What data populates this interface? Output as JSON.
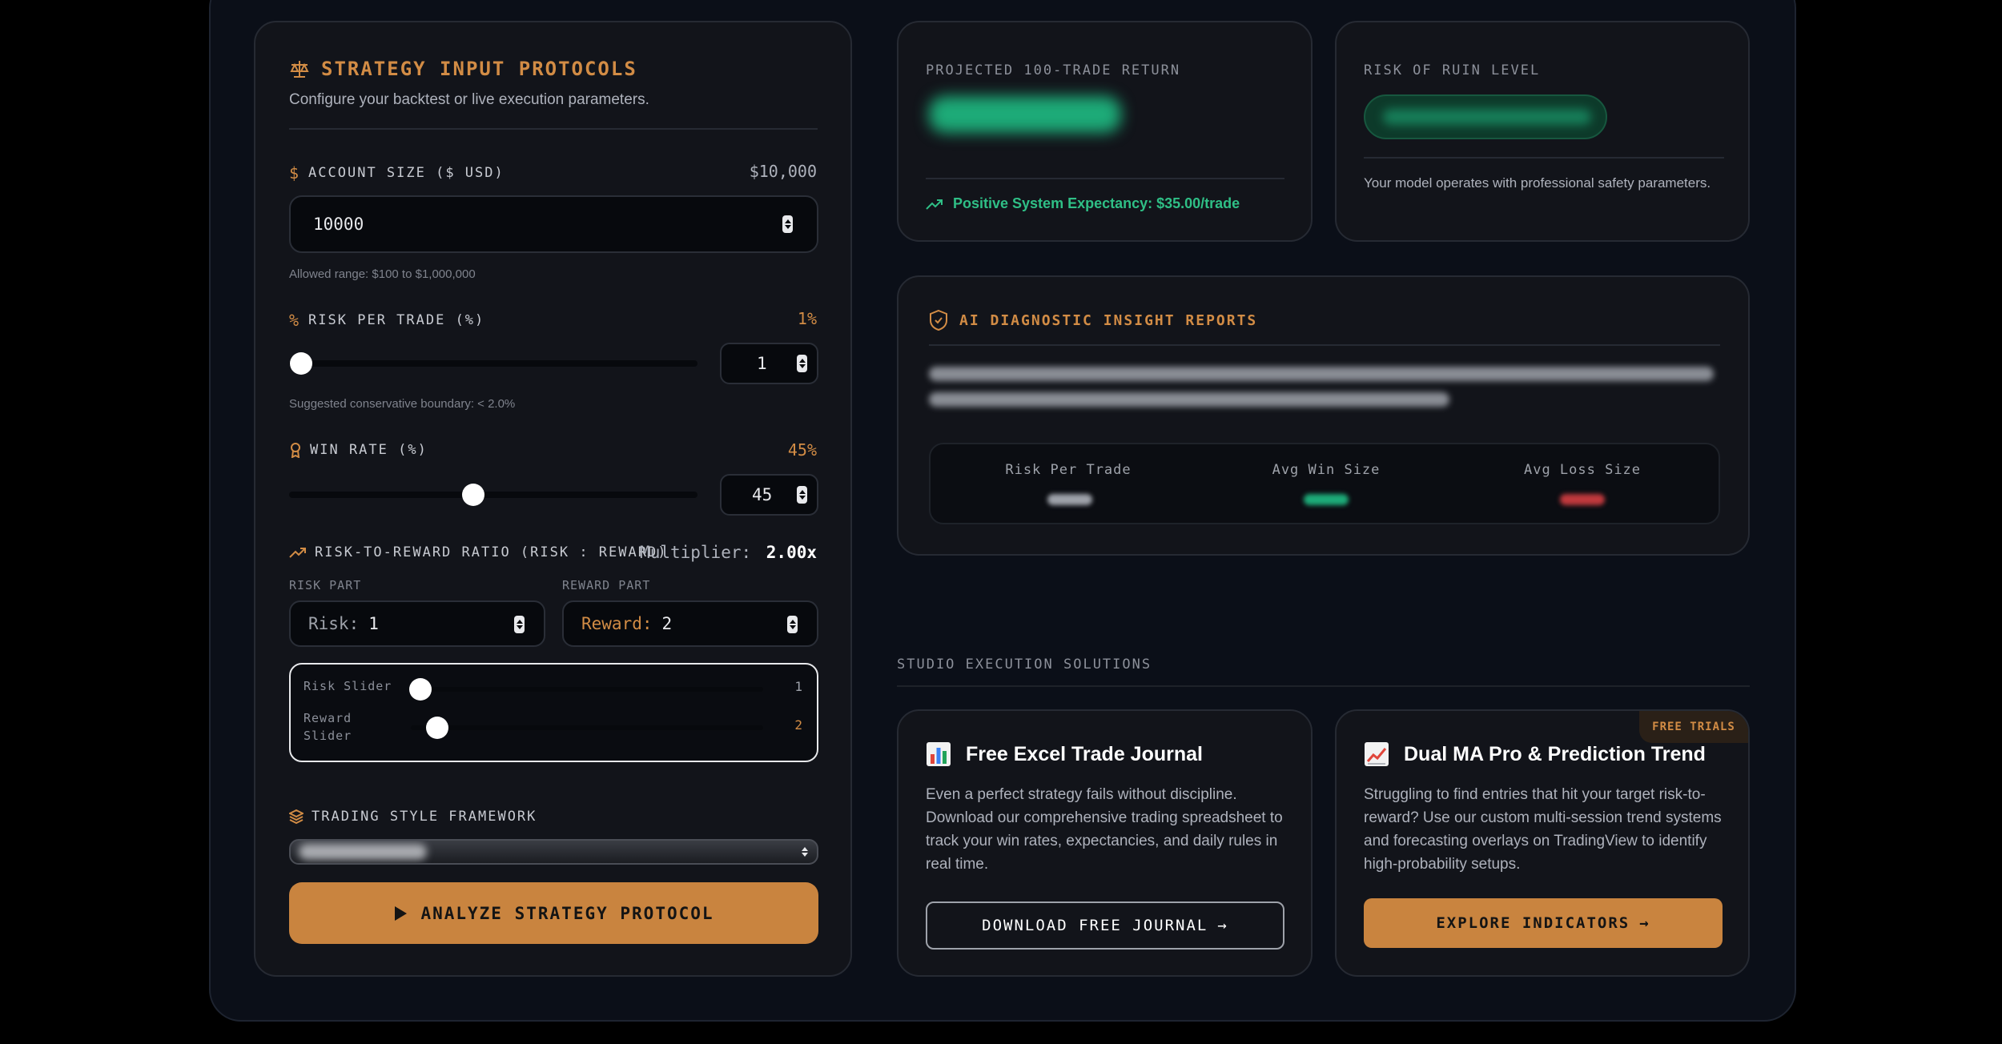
{
  "strategy": {
    "title": "STRATEGY INPUT PROTOCOLS",
    "subtitle": "Configure your backtest or live execution parameters.",
    "account": {
      "label": "ACCOUNT SIZE ($ USD)",
      "display": "$10,000",
      "value": "10000",
      "hint": "Allowed range: $100 to $1,000,000"
    },
    "risk": {
      "label": "RISK PER TRADE (%)",
      "display": "1%",
      "value": "1",
      "hint": "Suggested conservative boundary: < 2.0%",
      "slider_fraction": 0.03
    },
    "win": {
      "label": "WIN RATE (%)",
      "display": "45%",
      "value": "45",
      "slider_fraction": 0.45
    },
    "rr": {
      "label": "RISK-TO-REWARD RATIO (RISK : REWARD)",
      "multiplier_label": "Multiplier:",
      "multiplier_value": "2.00x",
      "risk_part_label": "RISK PART",
      "reward_part_label": "REWARD PART",
      "risk_prefix": "Risk:",
      "risk_value": "1",
      "reward_prefix": "Reward:",
      "reward_value": "2",
      "risk_slider_label": "Risk Slider",
      "reward_slider_label": "Reward Slider",
      "risk_slider_value": "1",
      "reward_slider_value": "2"
    },
    "style": {
      "label": "TRADING STYLE FRAMEWORK"
    },
    "analyze_label": "ANALYZE STRATEGY PROTOCOL"
  },
  "projection": {
    "kicker": "PROJECTED 100-TRADE RETURN",
    "expectancy": "Positive System Expectancy: $35.00/trade"
  },
  "ruin": {
    "kicker": "RISK OF RUIN LEVEL",
    "description": "Your model operates with professional safety parameters."
  },
  "ai": {
    "title": "AI DIAGNOSTIC INSIGHT REPORTS",
    "metrics": [
      "Risk Per Trade",
      "Avg Win Size",
      "Avg Loss Size"
    ]
  },
  "solutions": {
    "heading": "STUDIO EXECUTION SOLUTIONS",
    "excel": {
      "title": "Free Excel Trade Journal",
      "description": "Even a perfect strategy fails without discipline. Download our comprehensive trading spreadsheet to track your win rates, expectancies, and daily rules in real time.",
      "button": "DOWNLOAD FREE JOURNAL"
    },
    "dual": {
      "badge": "FREE TRIALS",
      "title": "Dual MA Pro & Prediction Trend",
      "description": "Struggling to find entries that hit your target risk-to-reward? Use our custom multi-session trend systems and forecasting overlays on TradingView to identify high-probability setups.",
      "button": "EXPLORE INDICATORS"
    }
  },
  "colors": {
    "accent": "#d28c45",
    "button": "#c9843f",
    "positive": "#2fbf86",
    "panel": "#12141a",
    "background": "#0b0f18"
  }
}
